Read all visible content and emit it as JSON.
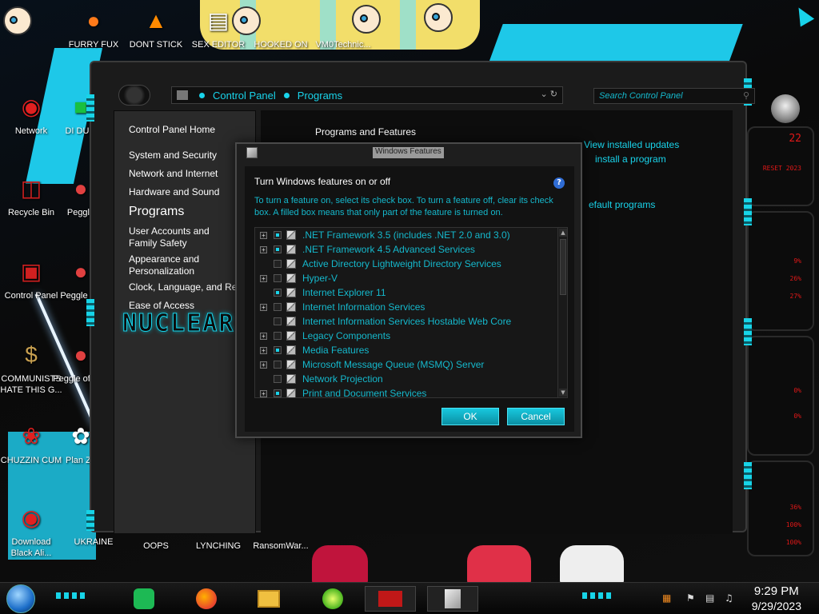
{
  "desktop": {
    "top_icons": [
      {
        "label": "FURRY FUX"
      },
      {
        "label": "DONT STICK"
      },
      {
        "label": "SEX EDITOR"
      },
      {
        "label": "HOOKED ON"
      },
      {
        "label": "VM0Technic..."
      }
    ],
    "left_icons": [
      {
        "label": "Network"
      },
      {
        "label": "DI DUM"
      },
      {
        "label": "Recycle Bin"
      },
      {
        "label": "Peggle"
      },
      {
        "label": "Control Panel"
      },
      {
        "label": "Peggle De"
      },
      {
        "label": "COMMUNISTS HATE THIS G..."
      },
      {
        "label": "Peggle of War"
      },
      {
        "label": "CHUZZIN CUM"
      },
      {
        "label": "Plan Zo"
      },
      {
        "label": "Download Black Ali..."
      },
      {
        "label": "UKRAINE"
      }
    ],
    "bottom_labels": [
      {
        "label": "OOPS"
      },
      {
        "label": "LYNCHING"
      },
      {
        "label": "RansomWar..."
      }
    ]
  },
  "widget": {
    "readouts": [
      "22",
      "RESET 2023",
      "9%",
      "26%",
      "27%",
      "0%",
      "0%",
      "36%",
      "100%",
      "100%"
    ]
  },
  "window": {
    "breadcrumb": [
      "Control Panel",
      "Programs"
    ],
    "search_placeholder": "Search Control Panel",
    "sidebar": {
      "home": "Control Panel Home",
      "items": [
        "System and Security",
        "Network and Internet",
        "Hardware and Sound"
      ],
      "current": "Programs",
      "items2": [
        "User Accounts and Family Safety",
        "Appearance and Personalization",
        "Clock, Language, and Region",
        "Ease of Access"
      ],
      "brand": "NUCLEAR"
    },
    "content": {
      "title": "Programs and Features",
      "links": [
        "View installed updates",
        "install a program",
        "efault programs"
      ]
    }
  },
  "dialog": {
    "title": "Windows Features",
    "heading": "Turn Windows features on or off",
    "help": "?",
    "description": "To turn a feature on, select its check box. To turn a feature off, clear its check box. A filled box means that only part of the feature is turned on.",
    "features": [
      {
        "name": ".NET Framework 3.5 (includes .NET 2.0 and 3.0)",
        "expandable": true,
        "state": "partial"
      },
      {
        "name": ".NET Framework 4.5 Advanced Services",
        "expandable": true,
        "state": "partial"
      },
      {
        "name": "Active Directory Lightweight Directory Services",
        "expandable": false,
        "state": "off"
      },
      {
        "name": "Hyper-V",
        "expandable": true,
        "state": "off"
      },
      {
        "name": "Internet Explorer 11",
        "expandable": false,
        "state": "partial"
      },
      {
        "name": "Internet Information Services",
        "expandable": true,
        "state": "off"
      },
      {
        "name": "Internet Information Services Hostable Web Core",
        "expandable": false,
        "state": "off"
      },
      {
        "name": "Legacy Components",
        "expandable": true,
        "state": "off"
      },
      {
        "name": "Media Features",
        "expandable": true,
        "state": "partial"
      },
      {
        "name": "Microsoft Message Queue (MSMQ) Server",
        "expandable": true,
        "state": "off"
      },
      {
        "name": "Network Projection",
        "expandable": false,
        "state": "off"
      },
      {
        "name": "Print and Document Services",
        "expandable": true,
        "state": "partial"
      }
    ],
    "ok_label": "OK",
    "cancel_label": "Cancel"
  },
  "taskbar": {
    "time": "9:29 PM",
    "date": "9/29/2023"
  },
  "colors": {
    "accent": "#19d3ea",
    "window_bg": "#1b1b1b",
    "widget_text": "#e01818"
  }
}
